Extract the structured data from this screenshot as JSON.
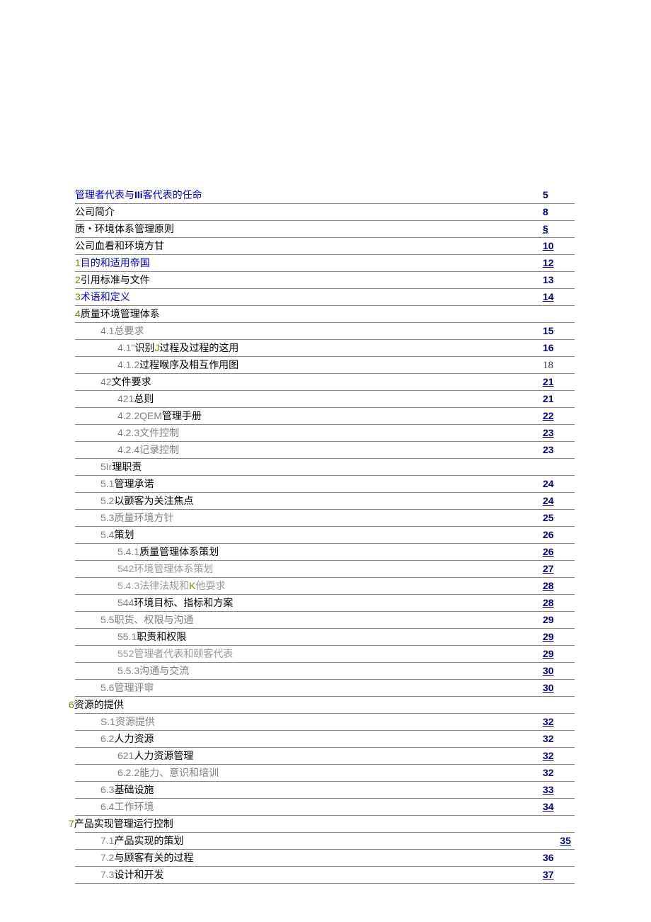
{
  "rows": [
    {
      "indent": 0,
      "parts": [
        {
          "t": "管理者代表与",
          "cls": "c-blue"
        },
        {
          "t": "IIi",
          "cls": "c-blue bold arial"
        },
        {
          "t": "客代表的任命",
          "cls": "c-blue"
        }
      ],
      "page": "5",
      "pcls": "c-navy"
    },
    {
      "indent": 0,
      "parts": [
        {
          "t": "公司简介",
          "cls": "c-black"
        }
      ],
      "page": "8",
      "pcls": "c-navy"
    },
    {
      "indent": 0,
      "parts": [
        {
          "t": "质・环境体系管理原则",
          "cls": "c-black"
        }
      ],
      "page": "§",
      "pcls": "c-navy underline"
    },
    {
      "indent": 0,
      "parts": [
        {
          "t": "公司血看和环境方甘",
          "cls": "c-black"
        }
      ],
      "page": "10",
      "pcls": "c-navy underline"
    },
    {
      "indent": 0,
      "parts": [
        {
          "t": "1",
          "cls": "c-green arial"
        },
        {
          "t": "目的和适用帝国",
          "cls": "c-blue"
        }
      ],
      "page": "12",
      "pcls": "c-navy underline"
    },
    {
      "indent": 0,
      "parts": [
        {
          "t": "2",
          "cls": "c-green arial"
        },
        {
          "t": "引用标准与文件",
          "cls": "c-black"
        }
      ],
      "page": "13",
      "pcls": "c-navy"
    },
    {
      "indent": 0,
      "parts": [
        {
          "t": "3",
          "cls": "c-green arial"
        },
        {
          "t": "术语和定义",
          "cls": "c-blue"
        }
      ],
      "page": "14",
      "pcls": "c-navy underline"
    },
    {
      "indent": 0,
      "parts": [
        {
          "t": "4",
          "cls": "c-green arial"
        },
        {
          "t": "质量环境管理体系",
          "cls": "c-black"
        }
      ],
      "page": "",
      "pcls": ""
    },
    {
      "indent": 1,
      "parts": [
        {
          "t": "4.1",
          "cls": "c-gray arial"
        },
        {
          "t": "总要求",
          "cls": "c-gray"
        }
      ],
      "page": "15",
      "pcls": "c-navy"
    },
    {
      "indent": 2,
      "parts": [
        {
          "t": "4.1\"",
          "cls": "c-gray arial"
        },
        {
          "t": "识别",
          "cls": "c-black"
        },
        {
          "t": "J",
          "cls": "c-green arial"
        },
        {
          "t": "过程及过程的这用",
          "cls": "c-black"
        }
      ],
      "page": "16",
      "pcls": "c-navy"
    },
    {
      "indent": 2,
      "parts": [
        {
          "t": "4.1.2",
          "cls": "c-gray arial"
        },
        {
          "t": "过程喉序及相互作用图",
          "cls": "c-black"
        }
      ],
      "page": "18",
      "pcls": "serif-page"
    },
    {
      "indent": 1,
      "parts": [
        {
          "t": "42",
          "cls": "c-gray arial"
        },
        {
          "t": "文件要求",
          "cls": "c-black"
        }
      ],
      "page": "21",
      "pcls": "c-navy underline"
    },
    {
      "indent": 2,
      "parts": [
        {
          "t": "421",
          "cls": "c-gray arial"
        },
        {
          "t": "总则",
          "cls": "c-black"
        }
      ],
      "page": "21",
      "pcls": "c-navy"
    },
    {
      "indent": 2,
      "parts": [
        {
          "t": "4.2.2QEM",
          "cls": "c-gray arial"
        },
        {
          "t": "管理手册",
          "cls": "c-black"
        }
      ],
      "page": "22",
      "pcls": "c-navy underline"
    },
    {
      "indent": 2,
      "parts": [
        {
          "t": "4.2.3",
          "cls": "c-gray arial"
        },
        {
          "t": "文件控制",
          "cls": "c-gray"
        }
      ],
      "page": "23",
      "pcls": "c-navy underline"
    },
    {
      "indent": 2,
      "parts": [
        {
          "t": "4.2.4",
          "cls": "c-gray arial"
        },
        {
          "t": "记录控制",
          "cls": "c-gray"
        }
      ],
      "page": "23",
      "pcls": "c-navy"
    },
    {
      "indent": 1,
      "parts": [
        {
          "t": "5Ir",
          "cls": "c-gray arial"
        },
        {
          "t": "理职责",
          "cls": "c-black"
        }
      ],
      "page": "",
      "pcls": ""
    },
    {
      "indent": 1,
      "parts": [
        {
          "t": "5.1",
          "cls": "c-gray arial"
        },
        {
          "t": "管理承诺",
          "cls": "c-black"
        }
      ],
      "page": "24",
      "pcls": "c-navy"
    },
    {
      "indent": 1,
      "parts": [
        {
          "t": "5.2",
          "cls": "c-gray arial"
        },
        {
          "t": "以颤客为关注焦点",
          "cls": "c-black"
        }
      ],
      "page": "24",
      "pcls": "c-navy underline"
    },
    {
      "indent": 1,
      "parts": [
        {
          "t": "5.3",
          "cls": "c-gray arial"
        },
        {
          "t": "质量环境方针",
          "cls": "c-gray"
        }
      ],
      "page": "25",
      "pcls": "c-navy"
    },
    {
      "indent": 1,
      "parts": [
        {
          "t": "5.4",
          "cls": "c-gray arial"
        },
        {
          "t": "策划",
          "cls": "c-black"
        }
      ],
      "page": "26",
      "pcls": "c-navy"
    },
    {
      "indent": 2,
      "parts": [
        {
          "t": "5.4.1",
          "cls": "c-gray arial"
        },
        {
          "t": "质量管理体系策划",
          "cls": "c-black"
        }
      ],
      "page": "26",
      "pcls": "c-navy underline"
    },
    {
      "indent": 2,
      "parts": [
        {
          "t": "542",
          "cls": "c-gray2 arial"
        },
        {
          "t": "环境管理体系策划",
          "cls": "c-gray2"
        }
      ],
      "page": "27",
      "pcls": "c-navy underline"
    },
    {
      "indent": 2,
      "parts": [
        {
          "t": "5.4.3",
          "cls": "c-gray2 arial"
        },
        {
          "t": "法律法规和",
          "cls": "c-gray2"
        },
        {
          "t": "K",
          "cls": "c-green arial"
        },
        {
          "t": "他耍求",
          "cls": "c-gray2"
        }
      ],
      "page": "28",
      "pcls": "c-navy underline"
    },
    {
      "indent": 2,
      "parts": [
        {
          "t": "544",
          "cls": "c-gray arial"
        },
        {
          "t": "环境目标、指标和方案",
          "cls": "c-black"
        }
      ],
      "page": "28",
      "pcls": "c-navy underline"
    },
    {
      "indent": 1,
      "parts": [
        {
          "t": "5.5",
          "cls": "c-gray arial"
        },
        {
          "t": "职货、权限与沟通",
          "cls": "c-gray"
        }
      ],
      "page": "29",
      "pcls": "c-navy"
    },
    {
      "indent": 2,
      "parts": [
        {
          "t": "55.1",
          "cls": "c-gray arial"
        },
        {
          "t": "职责和权限",
          "cls": "c-black"
        }
      ],
      "page": "29",
      "pcls": "c-navy underline"
    },
    {
      "indent": 2,
      "parts": [
        {
          "t": "552",
          "cls": "c-gray2 arial"
        },
        {
          "t": "管理者代表和颐客代表",
          "cls": "c-gray2"
        }
      ],
      "page": "29",
      "pcls": "c-navy underline"
    },
    {
      "indent": 2,
      "parts": [
        {
          "t": "5.5.3",
          "cls": "c-gray arial"
        },
        {
          "t": "沟通与交流",
          "cls": "c-gray"
        }
      ],
      "page": "30",
      "pcls": "c-navy underline"
    },
    {
      "indent": 1,
      "parts": [
        {
          "t": "5.6",
          "cls": "c-gray arial"
        },
        {
          "t": "管理评审",
          "cls": "c-gray"
        }
      ],
      "page": "30",
      "pcls": "c-navy underline"
    },
    {
      "indent": 0,
      "offsetLeft": true,
      "parts": [
        {
          "t": "6",
          "cls": "c-green arial"
        },
        {
          "t": "资源的提供",
          "cls": "c-black"
        }
      ],
      "page": "",
      "pcls": ""
    },
    {
      "indent": 1,
      "parts": [
        {
          "t": "S.1",
          "cls": "c-gray arial"
        },
        {
          "t": "资源提供",
          "cls": "c-gray"
        }
      ],
      "page": "32",
      "pcls": "c-navy underline"
    },
    {
      "indent": 1,
      "parts": [
        {
          "t": "6.2",
          "cls": "c-gray arial"
        },
        {
          "t": "人力资源",
          "cls": "c-black"
        }
      ],
      "page": "32",
      "pcls": "c-navy"
    },
    {
      "indent": 2,
      "parts": [
        {
          "t": "621",
          "cls": "c-gray arial"
        },
        {
          "t": "人力资源管理",
          "cls": "c-black"
        }
      ],
      "page": "32",
      "pcls": "c-navy underline"
    },
    {
      "indent": 2,
      "parts": [
        {
          "t": "6.2.2",
          "cls": "c-gray arial"
        },
        {
          "t": "能力、意识和培训",
          "cls": "c-gray"
        }
      ],
      "page": "32",
      "pcls": "c-navy"
    },
    {
      "indent": 1,
      "parts": [
        {
          "t": "6.3",
          "cls": "c-gray arial"
        },
        {
          "t": "基础设施",
          "cls": "c-black"
        }
      ],
      "page": "33",
      "pcls": "c-navy underline"
    },
    {
      "indent": 1,
      "parts": [
        {
          "t": "6.4",
          "cls": "c-gray arial"
        },
        {
          "t": "工作环境",
          "cls": "c-gray"
        }
      ],
      "page": "34",
      "pcls": "c-navy underline"
    },
    {
      "indent": 0,
      "offsetLeft": true,
      "parts": [
        {
          "t": "7",
          "cls": "c-green arial"
        },
        {
          "t": "产品实现管理运行控制",
          "cls": "c-black"
        }
      ],
      "page": "",
      "pcls": ""
    },
    {
      "indent": 1,
      "parts": [
        {
          "t": "7.1",
          "cls": "c-gray arial"
        },
        {
          "t": "产品实现的策划",
          "cls": "c-black"
        }
      ],
      "page": "35",
      "pcls": "c-navy underline",
      "pright": true
    },
    {
      "indent": 1,
      "parts": [
        {
          "t": "7.2",
          "cls": "c-gray arial"
        },
        {
          "t": "与顾客有关的过程",
          "cls": "c-black"
        }
      ],
      "page": "36",
      "pcls": "c-navy"
    },
    {
      "indent": 1,
      "parts": [
        {
          "t": "7.3",
          "cls": "c-gray arial"
        },
        {
          "t": "设计和开发",
          "cls": "c-black"
        }
      ],
      "page": "37",
      "pcls": "c-navy underline"
    }
  ]
}
